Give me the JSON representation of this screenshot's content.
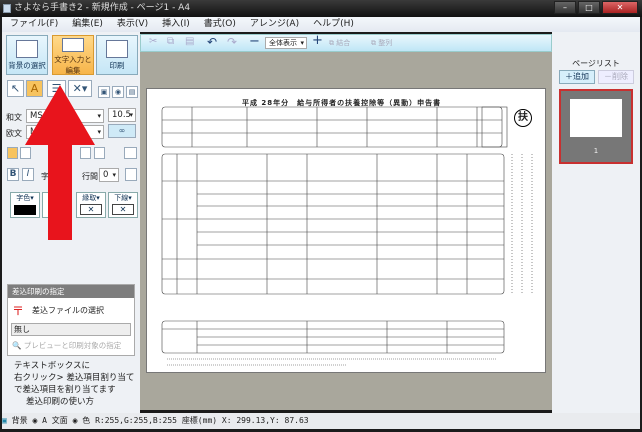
{
  "window": {
    "title": "さよなら手書き2 - 新規作成 - ページ1 - A4"
  },
  "menu": [
    "ファイル(F)",
    "編集(E)",
    "表示(V)",
    "挿入(I)",
    "書式(O)",
    "アレンジ(A)",
    "ヘルプ(H)"
  ],
  "left": {
    "mode_buttons": [
      "背景の選択",
      "文字入力と編集",
      "印刷"
    ],
    "wabun_label": "和文",
    "wabun_font": "MS PI",
    "font_size": "10.5",
    "oubun_label": "欧文",
    "oubun_font": "MS P",
    "char_label": "字",
    "line_spacing_label": "行間",
    "line_spacing": "0",
    "color_buttons": [
      "字色",
      "背景",
      "縁取",
      "下線"
    ],
    "merge": {
      "header": "差込印刷の指定",
      "select_file": "差込ファイルの選択",
      "file_value": "無し",
      "preview": "プレビューと印刷対象の指定"
    },
    "help_text": [
      "テキストボックスに",
      "右クリック> 差込項目割り当て",
      "で差込項目を割り当てます",
      "差込印刷の使い方"
    ]
  },
  "toolbar": {
    "zoom": "全体表示",
    "group": "結合",
    "align": "整列"
  },
  "document": {
    "title": "平成 28年分　給与所得者の扶養控除等（異動）申告書",
    "seal": "扶"
  },
  "right": {
    "title": "ページリスト",
    "add": "＋追加",
    "delete": "－削除",
    "thumb_label": "1"
  },
  "status": {
    "bg": "背景",
    "text": "文面",
    "color": "色 R:255,G:255,B:255",
    "coords": "座標(mm) X: 299.13,Y:  87.63"
  },
  "colors": {
    "accent": "#f7b54a",
    "arrow": "#e8141c",
    "selected_thumb": "#c83030"
  }
}
